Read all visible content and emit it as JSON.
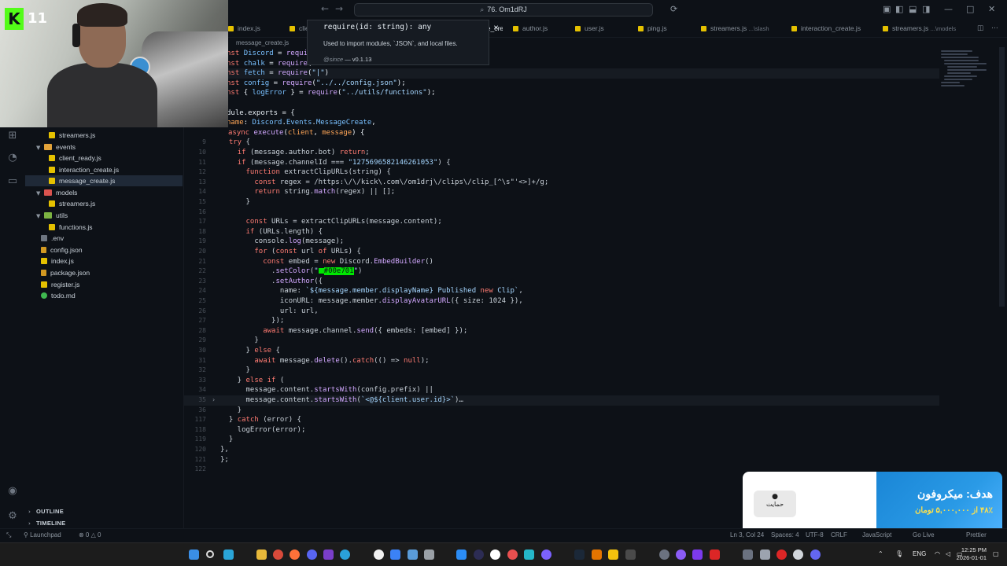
{
  "window": {
    "command_center": "76. Om1dRJ",
    "hover_badge": "11"
  },
  "tabs": [
    {
      "label": "index.js"
    },
    {
      "label": "client_r"
    },
    {
      "label": "message_create.js"
    },
    {
      "label": "author.js"
    },
    {
      "label": "user.js"
    },
    {
      "label": "ping.js"
    },
    {
      "label": "streamers.js",
      "hint": "...\\slash"
    },
    {
      "label": "interaction_create.js"
    },
    {
      "label": "streamers.js",
      "hint": "...\\models"
    }
  ],
  "breadcrumb": "message_create.js",
  "hover": {
    "signature": "require(id: string): any",
    "description": "Used to import modules, `JSON`, and local files.",
    "since_label": "@since",
    "since_value": "— v0.1.13"
  },
  "explorer": {
    "items": [
      {
        "label": "streamers.js",
        "type": "js"
      },
      {
        "label": "events",
        "type": "folder"
      },
      {
        "label": "client_ready.js",
        "type": "js"
      },
      {
        "label": "interaction_create.js",
        "type": "js"
      },
      {
        "label": "message_create.js",
        "type": "js",
        "selected": true
      },
      {
        "label": "models",
        "type": "folder-red"
      },
      {
        "label": "streamers.js",
        "type": "js"
      },
      {
        "label": "utils",
        "type": "folder-green"
      },
      {
        "label": "functions.js",
        "type": "js"
      },
      {
        "label": ".env",
        "type": "env"
      },
      {
        "label": "config.json",
        "type": "json"
      },
      {
        "label": "index.js",
        "type": "js"
      },
      {
        "label": "package.json",
        "type": "json"
      },
      {
        "label": "register.js",
        "type": "js"
      },
      {
        "label": "todo.md",
        "type": "md"
      }
    ],
    "outline_label": "OUTLINE",
    "timeline_label": "TIMELINE"
  },
  "code": {
    "line_numbers": [
      "9",
      "10",
      "11",
      "12",
      "13",
      "14",
      "15",
      "16",
      "17",
      "18",
      "19",
      "20",
      "21",
      "22",
      "23",
      "24",
      "25",
      "26",
      "27",
      "28",
      "29",
      "30",
      "31",
      "32",
      "33",
      "34",
      "35",
      "36",
      "117",
      "118",
      "119",
      "120",
      "121",
      "122",
      "123"
    ],
    "header_lines": [
      "nst Discord = require",
      "nst chalk = require(\"",
      "nst fetch = require(\"\")",
      "nst config = require(\"../../config.json\");",
      "nst { logError } = require(\"../utils/functions\");",
      "",
      "dule.exports = {",
      "name: Discord.Events.MessageCreate,",
      "async execute(client, message) {"
    ],
    "body_lines": [
      "  try {",
      "    if (message.author.bot) return;",
      "    if (message.channelId === \"1275696582146261053\") {",
      "      function extractClipURLs(string) {",
      "        const regex = /https:\\/\\/kick\\.com\\/om1drj\\/clips\\/clip_[^\\s\"'<>]+/g;",
      "        return string.match(regex) || [];",
      "      }",
      "",
      "      const URLs = extractClipURLs(message.content);",
      "      if (URLs.length) {",
      "        console.log(message);",
      "        for (const url of URLs) {",
      "          const embed = new Discord.EmbedBuilder()",
      "            .setColor(\"#00e701\")",
      "            .setAuthor({",
      "              name: `${message.member.displayName} Published new Clip`,",
      "              iconURL: message.member.displayAvatarURL({ size: 1024 }),",
      "              url: url,",
      "            });",
      "          await message.channel.send({ embeds: [embed] });",
      "        }",
      "      } else {",
      "        await message.delete().catch(() => null);",
      "      }",
      "    } else if (",
      "      message.content.startsWith(config.prefix) ||",
      "      message.content.startsWith(`<@${client.user.id}>`)…",
      "    }",
      "  } catch (error) {",
      "    logError(error);",
      "  }",
      "},",
      "};",
      ""
    ]
  },
  "donation": {
    "button_label": "حمایت",
    "goal_text": "هدف: میکروفون",
    "progress_text": "۴۸٪ از ۵,۰۰۰,۰۰۰ تومان",
    "progress_fraction": 0.48
  },
  "statusbar": {
    "launchpad": "Launchpad",
    "problems": "⊗ 0 △ 0",
    "position": "Ln 3, Col 24",
    "spaces": "Spaces: 4",
    "encoding": "UTF-8",
    "eol": "CRLF",
    "language": "JavaScript",
    "golive": "Go Live",
    "prettier": "Prettier"
  },
  "taskbar": {
    "language": "ENG",
    "time": "12:25 PM",
    "date": "2026-01-01"
  },
  "colors": {
    "editor_bg": "#0d1117",
    "accent_green": "#00e701",
    "kick_green": "#53fc18",
    "donate_blue": "#1a86d6"
  }
}
